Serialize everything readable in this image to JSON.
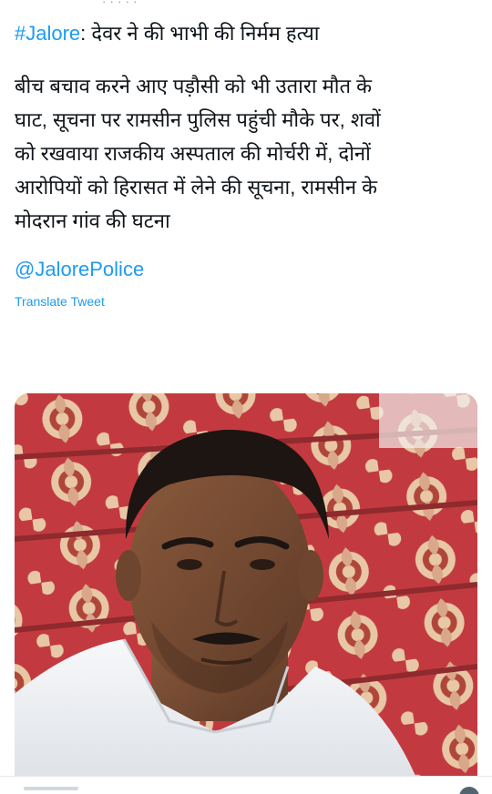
{
  "tweet": {
    "hashtag": "#Jalore",
    "headline_rest": ": देवर ने की भाभी की निर्मम हत्या",
    "body_lines": [
      "बीच बचाव करने आए पड़ौसी को भी उतारा मौत के",
      "घाट, सूचना पर रामसीन पुलिस पहुंची मौके पर, शवों",
      "को रखवाया राजकीय अस्पताल की मोर्चरी में, दोनों",
      "आरोपियों को हिरासत में लेने की सूचना, रामसीन के",
      "मोदरान गांव की घटना"
    ],
    "mention": "@JalorePolice",
    "translate_label": "Translate Tweet"
  },
  "colors": {
    "link": "#1d9bf0",
    "text": "#0f1419",
    "carpet_red": "#c23a3f",
    "carpet_pattern": "#e8c7a6",
    "shirt": "#f1f3f6"
  },
  "icons": {
    "photo": "man-portrait-photo",
    "bottom": "share-icon"
  }
}
